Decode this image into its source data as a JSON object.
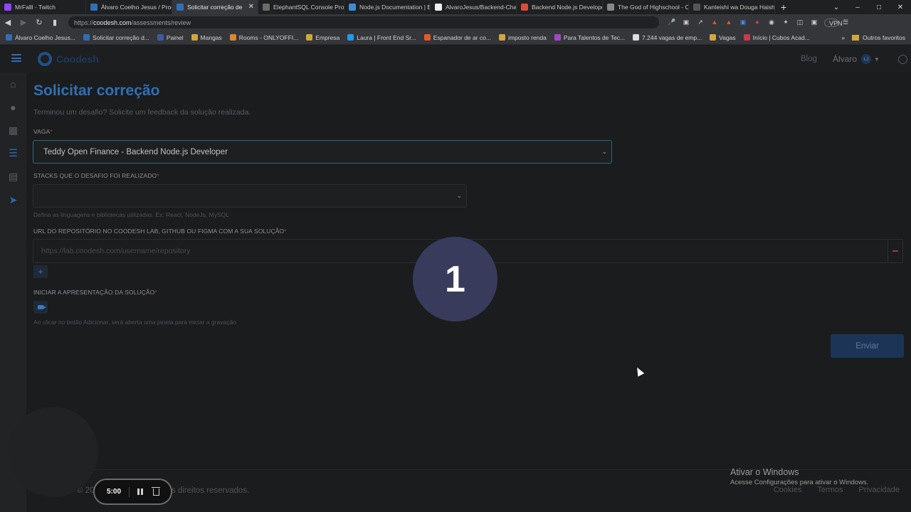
{
  "browser": {
    "tabs": [
      {
        "title": "MrFalll - Twitch",
        "color": "#9146ff"
      },
      {
        "title": "Álvaro Coelho Jesus / Prod",
        "color": "#2f6fb6"
      },
      {
        "title": "Solicitar correção de",
        "color": "#2f6fb6",
        "active": true
      },
      {
        "title": "ElephantSQL Console Proje",
        "color": "#6b6b6b"
      },
      {
        "title": "Node.js Documentation | El",
        "color": "#3d8cd6"
      },
      {
        "title": "AlvaroJesus/Backend-Chal",
        "color": "#eeeeee"
      },
      {
        "title": "Backend Node.js Developer",
        "color": "#d94b3a"
      },
      {
        "title": "The God of Highschool - C",
        "color": "#888888"
      },
      {
        "title": "Kanteishi wa Douga Haishin",
        "color": "#555555"
      }
    ],
    "url_scheme": "https://",
    "url_host": "coodesh.com",
    "url_path": "/assessments/review",
    "vpn": "VPN",
    "bookmarks": [
      {
        "label": "Álvaro Coelho Jesus...",
        "color": "#2f6fb6"
      },
      {
        "label": "Solicitar correção d...",
        "color": "#2f6fb6"
      },
      {
        "label": "Painel",
        "color": "#3b5ba9"
      },
      {
        "label": "Mangas",
        "color": "#d4a63a"
      },
      {
        "label": "Rooms - ONLYOFFI...",
        "color": "#e0852c"
      },
      {
        "label": "Empresa",
        "color": "#d4a63a"
      },
      {
        "label": "Laura | Front End Sr...",
        "color": "#1d9bf0"
      },
      {
        "label": "Espanador de ar co...",
        "color": "#e05a2a"
      },
      {
        "label": "imposto renda",
        "color": "#d4a63a"
      },
      {
        "label": "Para Talentos de Tec...",
        "color": "#a445c9"
      },
      {
        "label": "7.244 vagas de emp...",
        "color": "#dddddd"
      },
      {
        "label": "Vagas",
        "color": "#d4a63a"
      },
      {
        "label": "Início | Cubos Acad...",
        "color": "#c83a4a"
      }
    ],
    "bookmarks_more": "»",
    "other_bookmarks": "Outros favoritos"
  },
  "app": {
    "logo_text": "Coodesh",
    "blog": "Blog",
    "user_name": "Álvaro",
    "user_initials": "LJ"
  },
  "form": {
    "title": "Solicitar correção",
    "subtitle": "Terminou um desafio? Solicite um feedback da solução realizada.",
    "vaga_label": "VAGA",
    "vaga_value": "Teddy Open Finance - Backend Node.js Developer",
    "stacks_label": "STACKS QUE O DESAFIO FOI REALIZADO",
    "stacks_value": "",
    "stacks_hint": "Defina as linguagens e bibliotecas utilizadas. Ex: React, NodeJs, MySQL",
    "repo_label": "URL DO REPOSITÓRIO NO COODESH LAB, GITHUB OU FIGMA COM A SUA SOLUÇÃO",
    "repo_placeholder": "https://lab.coodesh.com/username/repository",
    "add_label": "+",
    "presentation_label": "INICIAR A APRESENTAÇÃO DA SOLUÇÃO",
    "presentation_hint": "Ao clicar no botão Adicionar, será aberta uma janela para iniciar a gravação",
    "required_mark": "*",
    "send_label": "Enviar"
  },
  "footer": {
    "copyright": "© 2023 Coodesh. Todos os direitos reservados.",
    "links": [
      "Cookies",
      "Termos",
      "Privacidade"
    ]
  },
  "overlay": {
    "countdown": "1",
    "recorder_time": "5:00",
    "activate_title": "Ativar o Windows",
    "activate_text": "Acesse Configurações para ativar o Windows."
  }
}
